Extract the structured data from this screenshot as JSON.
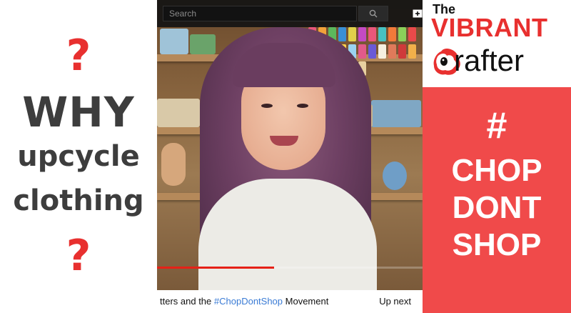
{
  "left": {
    "question_mark": "?",
    "headline": "WHY",
    "line1": "upcycle",
    "line2": "clothing"
  },
  "player": {
    "search_placeholder": "Search",
    "progress": 0.44,
    "caption_prefix": "tters and the ",
    "caption_hashtag": "#ChopDontShop",
    "caption_suffix": " Movement",
    "up_next": "Up next"
  },
  "right": {
    "logo_the": "The",
    "logo_vibrant": "VIBRANT",
    "logo_crafter": "rafter",
    "hash": "#",
    "word1": "CHOP",
    "word2": "DONT",
    "word3": "SHOP"
  },
  "colors": {
    "accent_red": "#e8302f",
    "panel_red": "#f04a4a",
    "dark_text": "#3d3d3d",
    "link_blue": "#3a7bd5"
  },
  "icons": [
    "search-icon",
    "add-video-icon",
    "sheep-logo-icon"
  ]
}
